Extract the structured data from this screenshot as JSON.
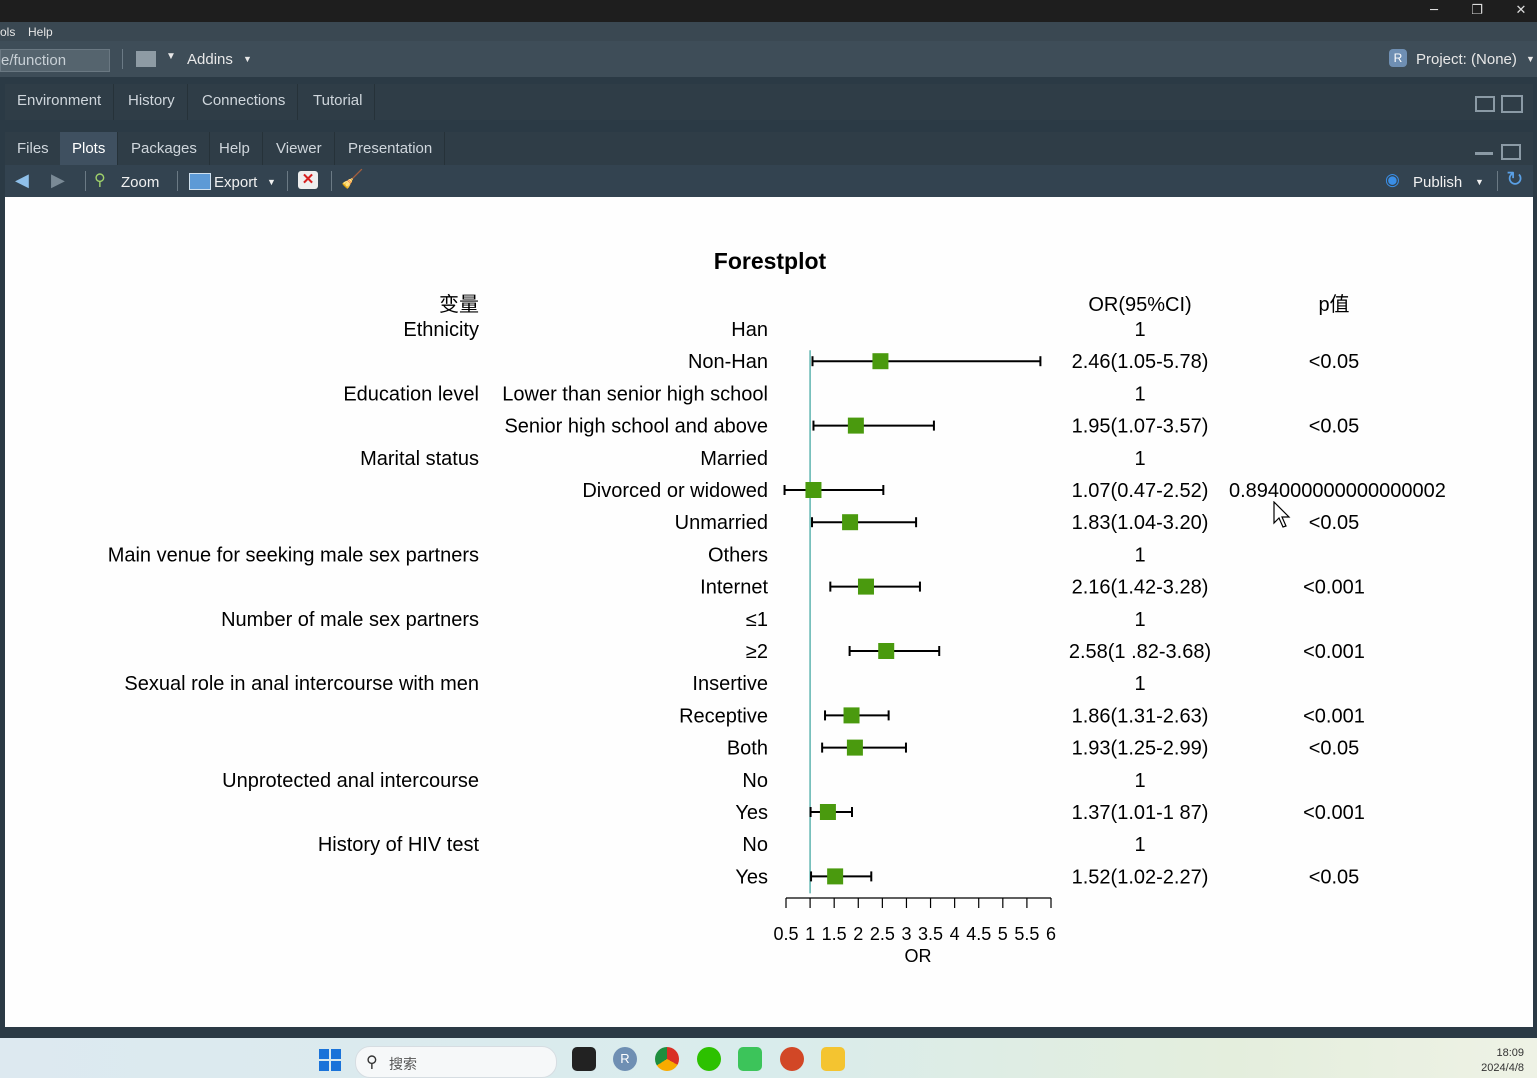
{
  "window": {
    "minimize": "─",
    "restore": "❐",
    "close": "✕"
  },
  "menu": {
    "tools_partial": "ols",
    "help": "Help"
  },
  "toolbar": {
    "path_field": "e/function",
    "addins": "Addins",
    "project": "Project: (None)"
  },
  "upper_pane": {
    "tabs": [
      "Environment",
      "History",
      "Connections",
      "Tutorial"
    ]
  },
  "lower_pane": {
    "tabs": [
      "Files",
      "Plots",
      "Packages",
      "Help",
      "Viewer",
      "Presentation"
    ],
    "active_tab": "Plots",
    "zoom": "Zoom",
    "export": "Export",
    "publish": "Publish"
  },
  "taskbar": {
    "search_placeholder": "搜索",
    "time": "18:09",
    "date": "2024/4/8"
  },
  "chart_data": {
    "type": "forestplot",
    "title": "Forestplot",
    "xlabel": "OR",
    "xlim": [
      0.5,
      6
    ],
    "xticks": [
      "0.5",
      "1",
      "1.5",
      "2",
      "2.5",
      "3",
      "3.5",
      "4",
      "4.5",
      "5",
      "5.5",
      "6"
    ],
    "reference_line": 1,
    "column_headers": {
      "variable": "变量",
      "level": "",
      "or_ci": "OR(95%CI)",
      "p": "p值"
    },
    "rows": [
      {
        "variable": "Ethnicity",
        "level": "Han",
        "or_text": "1",
        "p": ""
      },
      {
        "variable": "",
        "level": "Non-Han",
        "or": 2.46,
        "lower": 1.05,
        "upper": 5.78,
        "or_text": "2.46(1.05-5.78)",
        "p": "<0.05"
      },
      {
        "variable": "Education level",
        "level": "Lower than senior high school",
        "or_text": "1",
        "p": ""
      },
      {
        "variable": "",
        "level": "Senior high school and above",
        "or": 1.95,
        "lower": 1.07,
        "upper": 3.57,
        "or_text": "1.95(1.07-3.57)",
        "p": "<0.05"
      },
      {
        "variable": "Marital status",
        "level": "Married",
        "or_text": "1",
        "p": ""
      },
      {
        "variable": "",
        "level": "Divorced or widowed",
        "or": 1.07,
        "lower": 0.47,
        "upper": 2.52,
        "or_text": "1.07(0.47-2.52)",
        "p": "0.894000000000000002"
      },
      {
        "variable": "",
        "level": "Unmarried",
        "or": 1.83,
        "lower": 1.04,
        "upper": 3.2,
        "or_text": "1.83(1.04-3.20)",
        "p": "<0.05"
      },
      {
        "variable": "Main venue for seeking male sex partners",
        "level": "Others",
        "or_text": "1",
        "p": ""
      },
      {
        "variable": "",
        "level": "Internet",
        "or": 2.16,
        "lower": 1.42,
        "upper": 3.28,
        "or_text": "2.16(1.42-3.28)",
        "p": "<0.001"
      },
      {
        "variable": "Number of male sex partners",
        "level": "≤1",
        "or_text": "1",
        "p": ""
      },
      {
        "variable": "",
        "level": "≥2",
        "or": 2.58,
        "lower": 1.82,
        "upper": 3.68,
        "or_text": "2.58(1 .82-3.68)",
        "p": "<0.001"
      },
      {
        "variable": "Sexual role in anal intercourse with men",
        "level": "Insertive",
        "or_text": "1",
        "p": ""
      },
      {
        "variable": "",
        "level": "Receptive",
        "or": 1.86,
        "lower": 1.31,
        "upper": 2.63,
        "or_text": "1.86(1.31-2.63)",
        "p": "<0.001"
      },
      {
        "variable": "",
        "level": "Both",
        "or": 1.93,
        "lower": 1.25,
        "upper": 2.99,
        "or_text": "1.93(1.25-2.99)",
        "p": "<0.05"
      },
      {
        "variable": "Unprotected anal intercourse",
        "level": "No",
        "or_text": "1",
        "p": ""
      },
      {
        "variable": "",
        "level": "Yes",
        "or": 1.37,
        "lower": 1.01,
        "upper": 1.87,
        "or_text": "1.37(1.01-1 87)",
        "p": "<0.001"
      },
      {
        "variable": "History of HIV test",
        "level": "No",
        "or_text": "1",
        "p": ""
      },
      {
        "variable": "",
        "level": "Yes",
        "or": 1.52,
        "lower": 1.02,
        "upper": 2.27,
        "or_text": "1.52(1.02-2.27)",
        "p": "<0.05"
      }
    ],
    "colors": {
      "box": "#4a9a0e",
      "reference": "#5fb4b0",
      "line": "#000000"
    }
  }
}
